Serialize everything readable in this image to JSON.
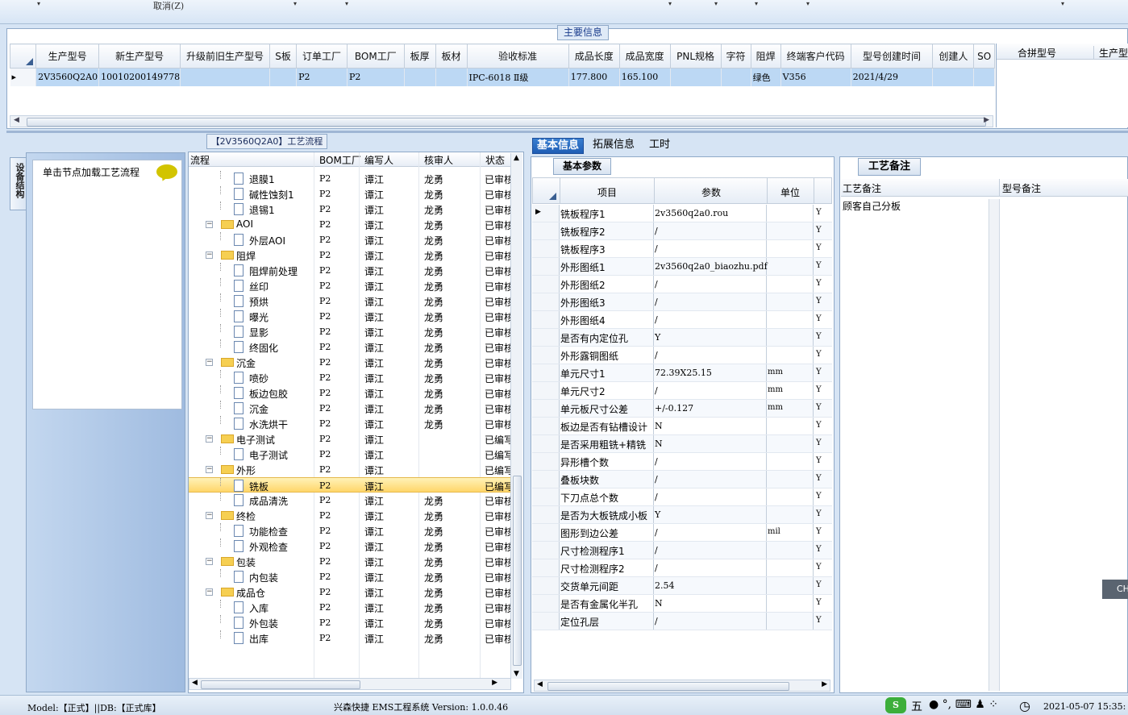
{
  "toolbar": {
    "cancel_label": "取消(Z)"
  },
  "main_info": {
    "title": "主要信息",
    "columns": [
      "生产型号",
      "新生产型号",
      "升级前旧生产型号",
      "S板",
      "订单工厂",
      "BOM工厂",
      "板厚",
      "板材",
      "验收标准",
      "成品长度",
      "成品宽度",
      "PNL规格",
      "字符",
      "阻焊",
      "终端客户代码",
      "型号创建时间",
      "创建人",
      "SO"
    ],
    "row": {
      "model": "2V3560Q2A0",
      "new_model": "10010200149778",
      "order_factory": "P2",
      "bom_factory": "P2",
      "standard": "IPC-6018 Ⅱ级",
      "length": "177.800",
      "width": "165.100",
      "solder": "绿色",
      "customer": "V356",
      "created": "2021/4/29"
    },
    "right_columns": [
      "合拼型号",
      "生产型"
    ]
  },
  "left": {
    "side_tab": "设备结构",
    "load_hint": "单击节点加载工艺流程"
  },
  "flow": {
    "title": "【2V3560Q2A0】工艺流程",
    "headers": [
      "流程",
      "BOM工厂",
      "编写人",
      "核审人",
      "状态"
    ],
    "rows": [
      {
        "name": "退膜1",
        "type": "doc",
        "bom": "P2",
        "writer": "谭江",
        "reviewer": "龙勇",
        "status": "已审核"
      },
      {
        "name": "碱性蚀刻1",
        "type": "doc",
        "bom": "P2",
        "writer": "谭江",
        "reviewer": "龙勇",
        "status": "已审核"
      },
      {
        "name": "退锡1",
        "type": "doc",
        "bom": "P2",
        "writer": "谭江",
        "reviewer": "龙勇",
        "status": "已审核"
      },
      {
        "name": "AOI",
        "type": "folder",
        "bom": "P2",
        "writer": "谭江",
        "reviewer": "龙勇",
        "status": "已审核"
      },
      {
        "name": "外层AOI",
        "type": "doc",
        "bom": "P2",
        "writer": "谭江",
        "reviewer": "龙勇",
        "status": "已审核"
      },
      {
        "name": "阻焊",
        "type": "folder",
        "bom": "P2",
        "writer": "谭江",
        "reviewer": "龙勇",
        "status": "已审核"
      },
      {
        "name": "阻焊前处理",
        "type": "doc",
        "bom": "P2",
        "writer": "谭江",
        "reviewer": "龙勇",
        "status": "已审核"
      },
      {
        "name": "丝印",
        "type": "doc",
        "bom": "P2",
        "writer": "谭江",
        "reviewer": "龙勇",
        "status": "已审核"
      },
      {
        "name": "预烘",
        "type": "doc",
        "bom": "P2",
        "writer": "谭江",
        "reviewer": "龙勇",
        "status": "已审核"
      },
      {
        "name": "曝光",
        "type": "doc",
        "bom": "P2",
        "writer": "谭江",
        "reviewer": "龙勇",
        "status": "已审核"
      },
      {
        "name": "显影",
        "type": "doc",
        "bom": "P2",
        "writer": "谭江",
        "reviewer": "龙勇",
        "status": "已审核"
      },
      {
        "name": "终固化",
        "type": "doc",
        "bom": "P2",
        "writer": "谭江",
        "reviewer": "龙勇",
        "status": "已审核"
      },
      {
        "name": "沉金",
        "type": "folder",
        "bom": "P2",
        "writer": "谭江",
        "reviewer": "龙勇",
        "status": "已审核"
      },
      {
        "name": "喷砂",
        "type": "doc",
        "bom": "P2",
        "writer": "谭江",
        "reviewer": "龙勇",
        "status": "已审核"
      },
      {
        "name": "板边包胶",
        "type": "doc",
        "bom": "P2",
        "writer": "谭江",
        "reviewer": "龙勇",
        "status": "已审核"
      },
      {
        "name": "沉金",
        "type": "doc",
        "bom": "P2",
        "writer": "谭江",
        "reviewer": "龙勇",
        "status": "已审核"
      },
      {
        "name": "水洗烘干",
        "type": "doc",
        "bom": "P2",
        "writer": "谭江",
        "reviewer": "龙勇",
        "status": "已审核"
      },
      {
        "name": "电子测试",
        "type": "folder",
        "bom": "P2",
        "writer": "谭江",
        "reviewer": "",
        "status": "已编写"
      },
      {
        "name": "电子测试",
        "type": "doc",
        "bom": "P2",
        "writer": "谭江",
        "reviewer": "",
        "status": "已编写"
      },
      {
        "name": "外形",
        "type": "folder",
        "bom": "P2",
        "writer": "谭江",
        "reviewer": "",
        "status": "已编写"
      },
      {
        "name": "铣板",
        "type": "doc",
        "bom": "P2",
        "writer": "谭江",
        "reviewer": "",
        "status": "已编写",
        "selected": true
      },
      {
        "name": "成品清洗",
        "type": "doc",
        "bom": "P2",
        "writer": "谭江",
        "reviewer": "龙勇",
        "status": "已审核"
      },
      {
        "name": "终检",
        "type": "folder",
        "bom": "P2",
        "writer": "谭江",
        "reviewer": "龙勇",
        "status": "已审核"
      },
      {
        "name": "功能检查",
        "type": "doc",
        "bom": "P2",
        "writer": "谭江",
        "reviewer": "龙勇",
        "status": "已审核"
      },
      {
        "name": "外观检查",
        "type": "doc",
        "bom": "P2",
        "writer": "谭江",
        "reviewer": "龙勇",
        "status": "已审核"
      },
      {
        "name": "包装",
        "type": "folder",
        "bom": "P2",
        "writer": "谭江",
        "reviewer": "龙勇",
        "status": "已审核"
      },
      {
        "name": "内包装",
        "type": "doc",
        "bom": "P2",
        "writer": "谭江",
        "reviewer": "龙勇",
        "status": "已审核"
      },
      {
        "name": "成品仓",
        "type": "folder",
        "bom": "P2",
        "writer": "谭江",
        "reviewer": "龙勇",
        "status": "已审核"
      },
      {
        "name": "入库",
        "type": "doc",
        "bom": "P2",
        "writer": "谭江",
        "reviewer": "龙勇",
        "status": "已审核"
      },
      {
        "name": "外包装",
        "type": "doc",
        "bom": "P2",
        "writer": "谭江",
        "reviewer": "龙勇",
        "status": "已审核"
      },
      {
        "name": "出库",
        "type": "doc",
        "bom": "P2",
        "writer": "谭江",
        "reviewer": "龙勇",
        "status": "已审核"
      }
    ]
  },
  "tabs": [
    "基本信息",
    "拓展信息",
    "工时"
  ],
  "basic": {
    "subtab": "基本参数",
    "headers": [
      "项目",
      "参数",
      "单位"
    ],
    "rows": [
      {
        "item": "铣板程序1",
        "param": "2v3560q2a0.rou",
        "unit": "",
        "flag": "Y"
      },
      {
        "item": "铣板程序2",
        "param": "/",
        "unit": "",
        "flag": "Y"
      },
      {
        "item": "铣板程序3",
        "param": "/",
        "unit": "",
        "flag": "Y"
      },
      {
        "item": "外形图纸1",
        "param": "2v3560q2a0_biaozhu.pdf",
        "unit": "",
        "flag": "Y"
      },
      {
        "item": "外形图纸2",
        "param": "/",
        "unit": "",
        "flag": "Y"
      },
      {
        "item": "外形图纸3",
        "param": "/",
        "unit": "",
        "flag": "Y"
      },
      {
        "item": "外形图纸4",
        "param": "/",
        "unit": "",
        "flag": "Y"
      },
      {
        "item": "是否有内定位孔",
        "param": "Y",
        "unit": "",
        "flag": "Y"
      },
      {
        "item": "外形露铜图纸",
        "param": "/",
        "unit": "",
        "flag": "Y"
      },
      {
        "item": "单元尺寸1",
        "param": "72.39X25.15",
        "unit": "mm",
        "flag": "Y"
      },
      {
        "item": "单元尺寸2",
        "param": "/",
        "unit": "mm",
        "flag": "Y"
      },
      {
        "item": "单元板尺寸公差",
        "param": "+/-0.127",
        "unit": "mm",
        "flag": "Y"
      },
      {
        "item": "板边是否有钻槽设计",
        "param": "N",
        "unit": "",
        "flag": "Y"
      },
      {
        "item": "是否采用粗铣+精铣",
        "param": "N",
        "unit": "",
        "flag": "Y"
      },
      {
        "item": "异形槽个数",
        "param": "/",
        "unit": "",
        "flag": "Y"
      },
      {
        "item": "叠板块数",
        "param": "/",
        "unit": "",
        "flag": "Y"
      },
      {
        "item": "下刀点总个数",
        "param": "/",
        "unit": "",
        "flag": "Y"
      },
      {
        "item": "是否为大板铣成小板",
        "param": "Y",
        "unit": "",
        "flag": "Y"
      },
      {
        "item": "图形到边公差",
        "param": "/",
        "unit": "mil",
        "flag": "Y"
      },
      {
        "item": "尺寸检测程序1",
        "param": "/",
        "unit": "",
        "flag": "Y"
      },
      {
        "item": "尺寸检测程序2",
        "param": "/",
        "unit": "",
        "flag": "Y"
      },
      {
        "item": "交货单元间距",
        "param": "2.54",
        "unit": "",
        "flag": "Y"
      },
      {
        "item": "是否有金属化半孔",
        "param": "N",
        "unit": "",
        "flag": "Y"
      },
      {
        "item": "定位孔层",
        "param": "/",
        "unit": "",
        "flag": "Y"
      }
    ]
  },
  "memo": {
    "tab": "工艺备注",
    "col1": "工艺备注",
    "col2": "型号备注",
    "value": "顾客自己分板"
  },
  "status": {
    "left": "Model:【正式】||DB:【正式库】",
    "center": "兴森快捷 EMS工程系统 Version: 1.0.0.46",
    "time": "2021-05-07 15:35:",
    "ime": "五",
    "float_btn": "CH"
  }
}
